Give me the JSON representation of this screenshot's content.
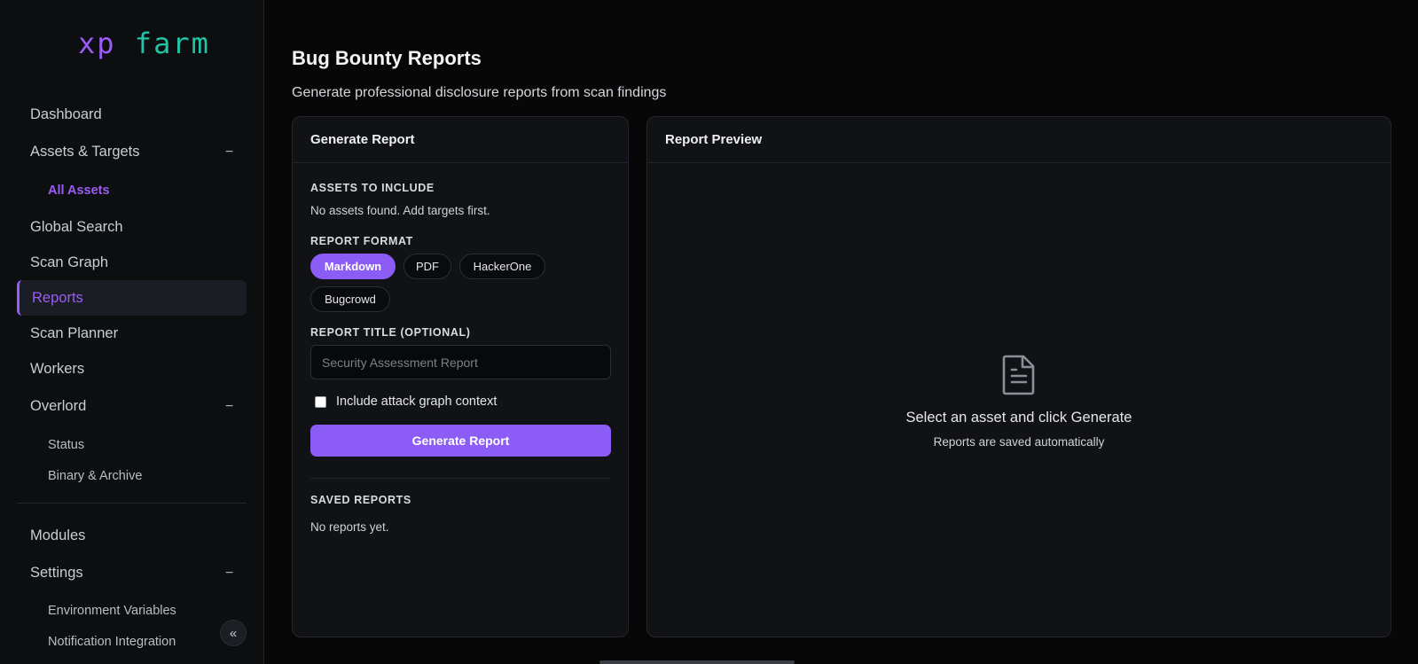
{
  "app": {
    "logo_xp": "xp",
    "logo_farm": "farm"
  },
  "sidebar": {
    "items": [
      {
        "label": "Dashboard"
      },
      {
        "label": "Assets & Targets",
        "toggle": "−"
      },
      {
        "label": "All Assets"
      },
      {
        "label": "Global Search"
      },
      {
        "label": "Scan Graph"
      },
      {
        "label": "Reports"
      },
      {
        "label": "Scan Planner"
      },
      {
        "label": "Workers"
      },
      {
        "label": "Overlord",
        "toggle": "−"
      },
      {
        "label": "Status"
      },
      {
        "label": "Binary & Archive"
      },
      {
        "label": "Modules"
      },
      {
        "label": "Settings",
        "toggle": "−"
      },
      {
        "label": "Environment Variables"
      },
      {
        "label": "Notification Integration"
      }
    ],
    "collapse_icon": "«"
  },
  "main": {
    "title": "Bug Bounty Reports",
    "subtitle": "Generate professional disclosure reports from scan findings"
  },
  "generate": {
    "heading": "Generate Report",
    "assets_label": "ASSETS TO INCLUDE",
    "assets_empty": "No assets found. Add targets first.",
    "format_label": "REPORT FORMAT",
    "formats": [
      "Markdown",
      "PDF",
      "HackerOne",
      "Bugcrowd"
    ],
    "selected_format": "Markdown",
    "title_label": "REPORT TITLE (OPTIONAL)",
    "title_placeholder": "Security Assessment Report",
    "title_value": "",
    "include_graph_label": "Include attack graph context",
    "include_graph_checked": false,
    "button_label": "Generate Report",
    "saved_label": "SAVED REPORTS",
    "saved_empty": "No reports yet."
  },
  "preview": {
    "heading": "Report Preview",
    "icon": "document-icon",
    "empty_title": "Select an asset and click Generate",
    "empty_sub": "Reports are saved automatically"
  },
  "colors": {
    "accent": "#8b5cf6",
    "logo_green": "#22c3a6",
    "background": "#070708"
  }
}
